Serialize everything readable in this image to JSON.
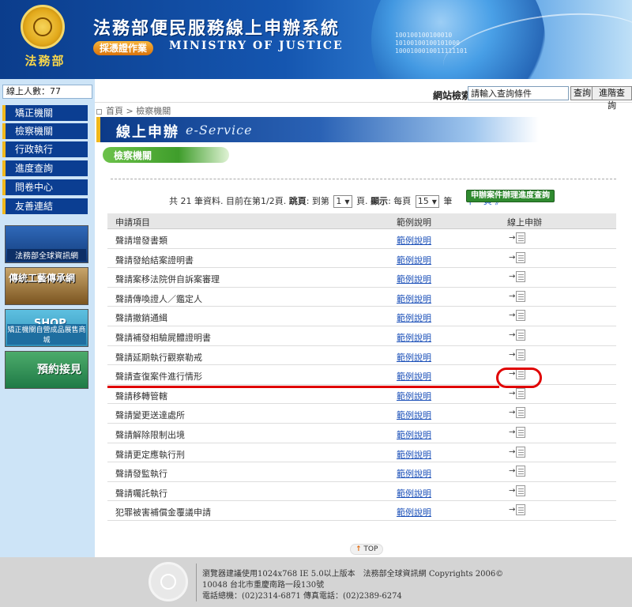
{
  "header": {
    "site_title": "法務部便民服務線上申辦系統",
    "badge": "採憑證作業",
    "ministry": "MINISTRY OF JUSTICE",
    "emblem_label": "法務部",
    "binary_lines": [
      "100100100100010",
      "10100100100101000",
      "1000100010011111101"
    ]
  },
  "sidebar": {
    "visitors": "線上人數：77",
    "nav": [
      "矯正機關",
      "檢察機關",
      "行政執行",
      "進度查詢",
      "問卷中心",
      "友善連結"
    ],
    "banners": {
      "moj_portal": "法務部全球資訊網",
      "craft": "傳統工藝傳承網",
      "shop_title": "SHOP",
      "shop_caption": "矯正機關自營成品展售商城",
      "visit": "預約接見"
    }
  },
  "topbar": {
    "search_label": "網站檢索",
    "search_placeholder": "請輸入查詢條件",
    "search_button": "查詢",
    "advanced_button": "進階查詢"
  },
  "breadcrumb": "首頁 > 檢察機關",
  "eservice": {
    "zh": "線上申辦",
    "en": "e-Service"
  },
  "section_title": "檢察機關",
  "pager": {
    "total_prefix": "共",
    "total": "21",
    "total_suffix": "筆資料. 目前在第1/2頁.",
    "jump_label": "跳頁",
    "jump_to": ": 到第",
    "page_value": "1",
    "page_unit": "頁.",
    "display_label": "顯示",
    "per_page_label": ": 每頁",
    "per_page_value": "15",
    "per_page_unit": "筆",
    "next": "下一頁 》"
  },
  "progress_button": "申辦案件辦理進度查詢",
  "table": {
    "headers": [
      "申請項目",
      "範例說明",
      "線上申辦"
    ],
    "example_text": "範例說明",
    "arrow": "→",
    "rows": [
      "聲請增發書類",
      "聲請發給結案證明書",
      "聲請案移法院併自訴案審理",
      "聲請傳喚證人／鑑定人",
      "聲請撤銷通緝",
      "聲請補發相驗屍體證明書",
      "聲請延期執行觀察勒戒",
      "聲請查復案件進行情形",
      "聲請移轉管轄",
      "聲請變更送達處所",
      "聲請解除限制出境",
      "聲請更定應執行刑",
      "聲請發監執行",
      "聲請囑託執行",
      "犯罪被害補償金覆議申請"
    ]
  },
  "top_link": {
    "arrow": "↑",
    "label": "TOP"
  },
  "footer": {
    "line1": "瀏覽器建議使用1024x768 IE 5.0以上版本　法務部全球資訊網 Copyrights 2006©",
    "line2": "10048 台北市重慶南路一段130號",
    "line3": "電話總機：(02)2314-6871 傳真電話：(02)2389-6274"
  },
  "colors": {
    "nav_bg": "#0b3e92",
    "accent_gold": "#f1b81c",
    "annotation_red": "#e00000",
    "link_blue": "#1a4fb8"
  }
}
